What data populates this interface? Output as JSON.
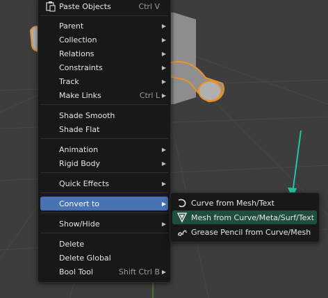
{
  "menu": {
    "items": [
      {
        "label": "Paste Objects",
        "shortcut": "Ctrl V",
        "icon": "paste-icon"
      },
      {
        "label": "Parent",
        "submenu": true
      },
      {
        "label": "Collection",
        "submenu": true
      },
      {
        "label": "Relations",
        "submenu": true
      },
      {
        "label": "Constraints",
        "submenu": true
      },
      {
        "label": "Track",
        "submenu": true
      },
      {
        "label": "Make Links",
        "shortcut": "Ctrl L",
        "submenu": true
      },
      {
        "label": "Shade Smooth"
      },
      {
        "label": "Shade Flat"
      },
      {
        "label": "Animation",
        "submenu": true
      },
      {
        "label": "Rigid Body",
        "submenu": true
      },
      {
        "label": "Quick Effects",
        "submenu": true
      },
      {
        "label": "Convert to",
        "submenu": true,
        "active": true
      },
      {
        "label": "Show/Hide",
        "submenu": true
      },
      {
        "label": "Delete"
      },
      {
        "label": "Delete Global"
      },
      {
        "label": "Bool Tool",
        "shortcut": "Shift Ctrl B",
        "submenu": true
      }
    ]
  },
  "convert_submenu": {
    "items": [
      {
        "label": "Curve from Mesh/Text",
        "icon": "curve-icon"
      },
      {
        "label": "Mesh from Curve/Meta/Surf/Text",
        "icon": "mesh-triangle-icon",
        "highlight": true
      },
      {
        "label": "Grease Pencil from Curve/Mesh",
        "icon": "grease-pencil-icon"
      }
    ]
  },
  "colors": {
    "menu_bg": "#181818",
    "active": "#4772b3",
    "annotation_arrow": "#1ec8a0",
    "selection_outline": "#e8922e"
  }
}
